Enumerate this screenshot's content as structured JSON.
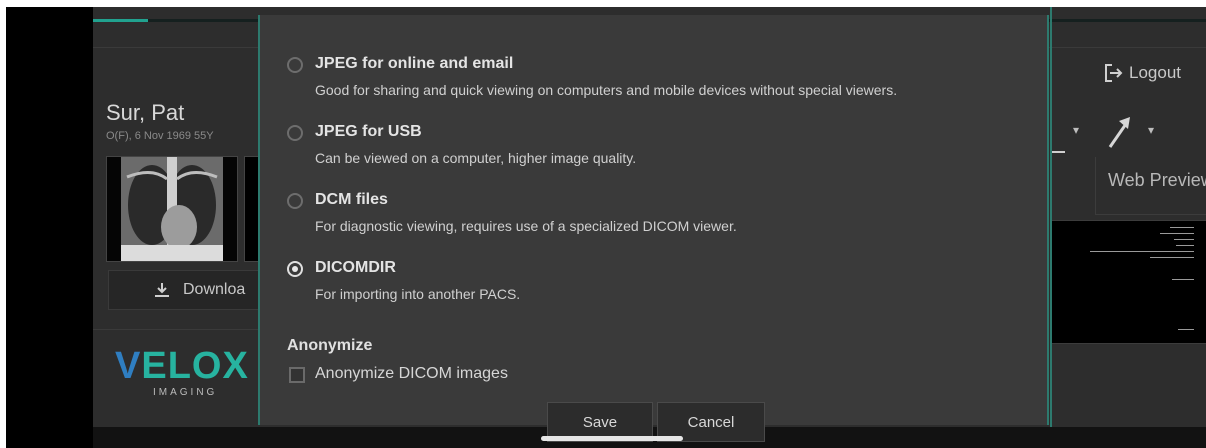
{
  "patient": {
    "name": "Sur, Pat",
    "info": "O(F), 6 Nov 1969 55Y"
  },
  "sidebar": {
    "download_label": "Downloa",
    "logo_word_v": "V",
    "logo_word_rest": "ELOX",
    "logo_sub": "IMAGING"
  },
  "header": {
    "logout_label": "Logout",
    "web_preview_label": "Web Preview"
  },
  "dialog": {
    "options": [
      {
        "title": "JPEG for online and email",
        "desc": "Good for sharing and quick viewing on computers and mobile devices without special viewers.",
        "selected": false
      },
      {
        "title": "JPEG for USB",
        "desc": "Can be viewed on a computer, higher image quality.",
        "selected": false
      },
      {
        "title": "DCM files",
        "desc": "For diagnostic viewing, requires use of a specialized DICOM viewer.",
        "selected": false
      },
      {
        "title": "DICOMDIR",
        "desc": "For importing into another PACS.",
        "selected": true
      }
    ],
    "anonymize_heading": "Anonymize",
    "anonymize_checkbox_label": "Anonymize DICOM images",
    "anonymize_checked": false,
    "save_label": "Save",
    "cancel_label": "Cancel"
  },
  "colors": {
    "accent": "#2d7a6e",
    "logo_teal": "#27b3a0",
    "logo_blue": "#2f7ec1"
  },
  "icons": {
    "download": "download-icon",
    "logout": "logout-icon",
    "arrow_tool": "arrow-tool-icon",
    "dropdown": "chevron-down-icon"
  }
}
